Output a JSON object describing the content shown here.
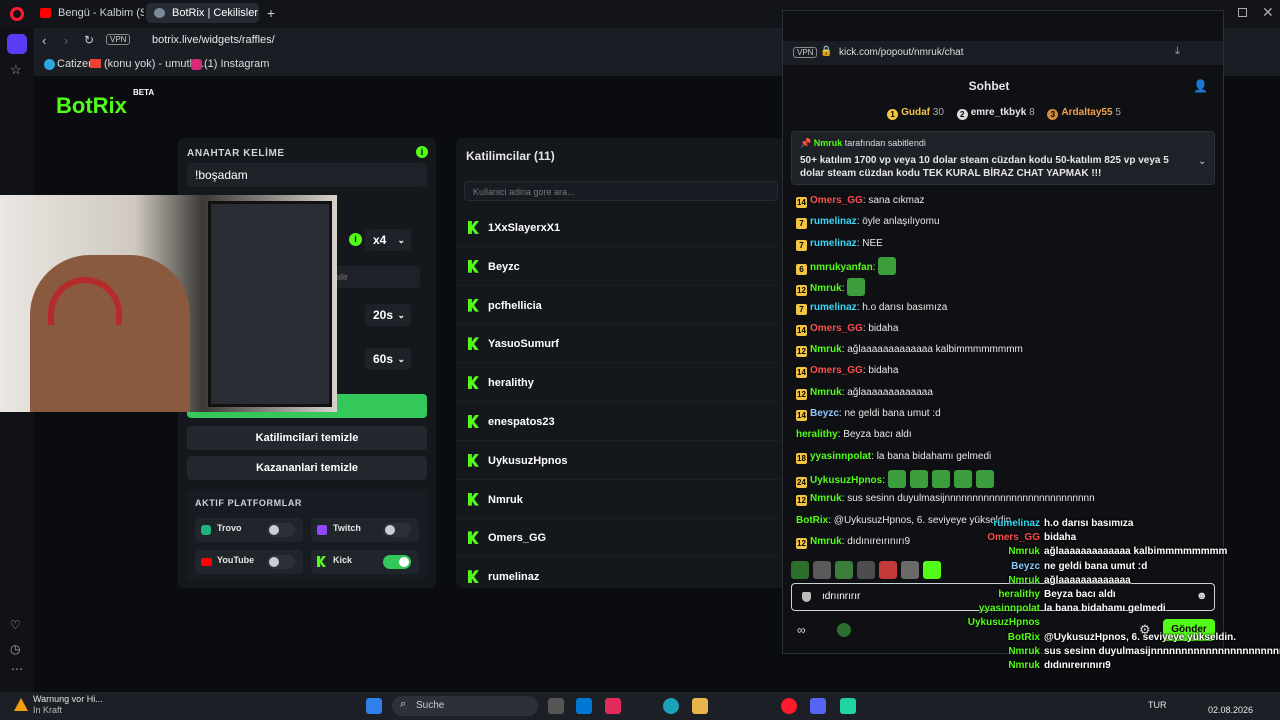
{
  "browser": {
    "tabs": [
      {
        "label": "Bengü - Kalbim (Slow"
      },
      {
        "label": "BotRix | Cekilisler"
      }
    ],
    "add_tab": "+",
    "address": "botrix.live/widgets/raffles/",
    "vpn": "VPN",
    "bookmarks": [
      "Catizen",
      "(konu yok) - umutka...",
      "(1) Instagram"
    ]
  },
  "botrix": {
    "logo": "BotRix",
    "logo_badge": "BETA",
    "keyword_label": "ANAHTAR KELİME",
    "keyword_value": "!boşadam",
    "multiplier": "x4",
    "hidden_hint": "bilir",
    "duration_a": "20s",
    "duration_b": "60s",
    "clear_participants": "Katilimcilari temizle",
    "clear_winners": "Kazananlari temizle",
    "platforms_label": "AKTIF PLATFORMLAR",
    "platforms": [
      {
        "name": "Trovo",
        "on": false,
        "color": "#1fb57a"
      },
      {
        "name": "Twitch",
        "on": false,
        "color": "#9146ff"
      },
      {
        "name": "YouTube",
        "on": false,
        "color": "#ff0000"
      },
      {
        "name": "Kick",
        "on": true,
        "color": "#53fc18"
      }
    ],
    "participants_title": "Katilimcilar (11)",
    "search_placeholder": "Kullanici adina gore ara...",
    "participants": [
      "1XxSlayerxX1",
      "Beyzc",
      "pcfhellicia",
      "YasuoSumurf",
      "heralithy",
      "enespatos23",
      "UykusuzHpnos",
      "Nmruk",
      "Omers_GG",
      "rumelinaz"
    ]
  },
  "chat": {
    "address": "kick.com/popout/nmruk/chat",
    "title": "Sohbet",
    "leaderboard": [
      {
        "name": "Gudaf",
        "count": "30"
      },
      {
        "name": "emre_tkbyk",
        "count": "8"
      },
      {
        "name": "Ardaltay55",
        "count": "5"
      }
    ],
    "pinned_by": "Nmruk",
    "pinned_suffix": "tarafından sabitlendi",
    "pinned_text": "50+ katılım 1700 vp veya 10 dolar steam cüzdan kodu 50-katılım 825 vp veya 5 dolar steam cüzdan kodu TEK KURAL BİRAZ CHAT YAPMAK !!!",
    "messages": [
      {
        "level": "14",
        "user": "Omers_GG",
        "color": "#ff4d4d",
        "text": "sana cıkmaz"
      },
      {
        "level": "7",
        "user": "rumelinaz",
        "color": "#38d9f5",
        "text": "öyle anlaşılıyomu"
      },
      {
        "level": "7",
        "user": "rumelinaz",
        "color": "#38d9f5",
        "text": "NEE"
      },
      {
        "level": "6",
        "user": "nmrukyanfan",
        "color": "#53fc18",
        "text": ""
      },
      {
        "level": "12",
        "user": "Nmruk",
        "color": "#53fc18",
        "text": ""
      },
      {
        "level": "7",
        "user": "rumelinaz",
        "color": "#38d9f5",
        "text": "h.o darısı basımıza"
      },
      {
        "level": "14",
        "user": "Omers_GG",
        "color": "#ff4d4d",
        "text": "bidaha"
      },
      {
        "level": "12",
        "user": "Nmruk",
        "color": "#53fc18",
        "text": "ağlaaaaaaaaaaaaa kalbimmmmmmmm"
      },
      {
        "level": "14",
        "user": "Omers_GG",
        "color": "#ff4d4d",
        "text": "bidaha"
      },
      {
        "level": "12",
        "user": "Nmruk",
        "color": "#53fc18",
        "text": "ağlaaaaaaaaaaaaa"
      },
      {
        "level": "14",
        "user": "Beyzc",
        "color": "#8ec8ff",
        "text": "ne geldi bana umut :d"
      },
      {
        "level": "",
        "user": "heralithy",
        "color": "#53fc18",
        "text": "Beyza bacı aldı"
      },
      {
        "level": "18",
        "user": "yyasinnpolat",
        "color": "#53fc18",
        "text": "la bana bidahamı gelmedi"
      },
      {
        "level": "24",
        "user": "UykusuzHpnos",
        "color": "#53fc18",
        "text": ""
      },
      {
        "level": "12",
        "user": "Nmruk",
        "color": "#53fc18",
        "text": "sus sesinn duyulmasijnnnnnnnnnnnnnnnnnnnnnnnnnnn"
      },
      {
        "level": "",
        "user": "BotRix",
        "color": "#53fc18",
        "text": "@UykusuzHpnos, 6. seviyeye yükseldin."
      },
      {
        "level": "12",
        "user": "Nmruk",
        "color": "#53fc18",
        "text": "dıdınıreırınırı9"
      }
    ],
    "input_value": "ıdrıınrırır",
    "send_label": "Gönder"
  },
  "overlay": [
    {
      "user": "rumelinaz",
      "text": "h.o darısı basımıza",
      "color": "#38d9f5"
    },
    {
      "user": "Omers_GG",
      "text": "bidaha",
      "color": "#ff4d4d"
    },
    {
      "user": "Nmruk",
      "text": "ağlaaaaaaaaaaaaa kalbimmmmmmmm",
      "color": "#53fc18"
    },
    {
      "user": "Beyzc",
      "text": "ne geldi bana umut :d",
      "color": "#8ec8ff"
    },
    {
      "user": "Nmruk",
      "text": "ağlaaaaaaaaaaaaa",
      "color": "#53fc18"
    },
    {
      "user": "heralithy",
      "text": "Beyza bacı aldı",
      "color": "#53fc18"
    },
    {
      "user": "yyasinnpolat",
      "text": "la bana bidahamı gelmedi",
      "color": "#53fc18"
    },
    {
      "user": "UykusuzHpnos",
      "text": "",
      "color": "#53fc18"
    },
    {
      "user": "BotRix",
      "text": "@UykusuzHpnos, 6. seviyeye yükseldin.",
      "color": "#53fc18"
    },
    {
      "user": "Nmruk",
      "text": "sus sesinn duyulmasijnnnnnnnnnnnnnnnnnnnnnnnnnnn",
      "color": "#53fc18"
    },
    {
      "user": "Nmruk",
      "text": "dıdınıreırınırı9",
      "color": "#53fc18"
    }
  ],
  "taskbar": {
    "warning_title": "Warnung vor Hi...",
    "warning_sub": "In Kraft",
    "search": "Suche",
    "lang": "TUR",
    "date": "02.08.2026"
  }
}
